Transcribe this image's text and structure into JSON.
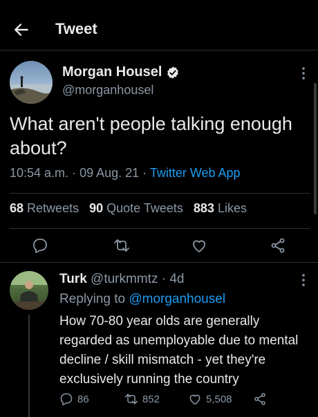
{
  "header": {
    "title": "Tweet"
  },
  "tweet": {
    "author_name": "Morgan Housel",
    "author_handle": "@morganhousel",
    "text": "What aren't people talking enough about?",
    "time": "10:54 a.m.",
    "date": "09 Aug. 21",
    "source": "Twitter Web App",
    "stats": {
      "retweets_count": "68",
      "retweets_label": "Retweets",
      "quotes_count": "90",
      "quotes_label": "Quote Tweets",
      "likes_count": "883",
      "likes_label": "Likes"
    }
  },
  "reply": {
    "author_name": "Turk",
    "author_handle": "@turkmmtz",
    "age": "4d",
    "replying_label": "Replying to",
    "replying_handle": "@morganhousel",
    "text": "How 70-80 year olds are generally regarded as unemployable due to mental decline / skill mismatch - yet they're exclusively running the country",
    "reply_count": "86",
    "retweet_count": "852",
    "like_count": "5,508"
  },
  "colors": {
    "background": "#000000",
    "text": "#e7e9ea",
    "secondary": "#8b98a5",
    "accent": "#1d9bf0",
    "divider": "#2f3336"
  },
  "icons": [
    "back-arrow-icon",
    "verified-badge-icon",
    "more-icon",
    "reply-icon",
    "retweet-icon",
    "like-icon",
    "share-icon"
  ]
}
